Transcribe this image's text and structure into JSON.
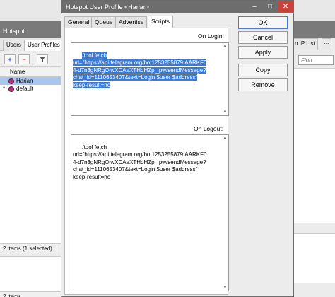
{
  "background": {
    "window_title": "Hotspot",
    "tabs": [
      "Users",
      "User Profiles"
    ],
    "right_tabs": [
      "n IP List",
      "..."
    ],
    "find_placeholder": "Find",
    "list_header": "Name",
    "rows": [
      {
        "marker": "",
        "name": "Harian",
        "selected": true
      },
      {
        "marker": "*",
        "name": "default",
        "selected": false
      }
    ],
    "status_upper": "2 items (1 selected)",
    "status_lower": "2 items"
  },
  "dialog": {
    "title": "Hotspot User Profile <Hariar>",
    "tabs": [
      "General",
      "Queue",
      "Advertise",
      "Scripts"
    ],
    "active_tab": "Scripts",
    "on_login_label": "On Login:",
    "on_logout_label": "On Logout:",
    "on_login_lines": [
      "/tool fetch",
      "url=\"https://api.telegram.org/bot1253255879:AARKF0",
      "4-d7n3gNRgOlwXCAeXTHqHZpl_pw/sendMessage?",
      "chat_id=1110653407&text=Login $user $address\"",
      "keep-result=no"
    ],
    "on_logout_lines": [
      "/tool fetch",
      "url=\"https://api.telegram.org/bot1253255879:AARKF0",
      "4-d7n3gNRgOlwXCAeXTHqHZpl_pw/sendMessage?",
      "chat_id=1110653407&text=Login $user $address\"",
      "keep-result=no"
    ],
    "buttons": {
      "ok": "OK",
      "cancel": "Cancel",
      "apply": "Apply",
      "copy": "Copy",
      "remove": "Remove"
    },
    "controls": {
      "minimize": "–",
      "maximize": "□",
      "close": "✕"
    }
  },
  "colors": {
    "selection": "#3a7ad8",
    "titlebar": "#6d6d6d",
    "close": "#c8443a",
    "profile_icon": "#b2327b"
  }
}
